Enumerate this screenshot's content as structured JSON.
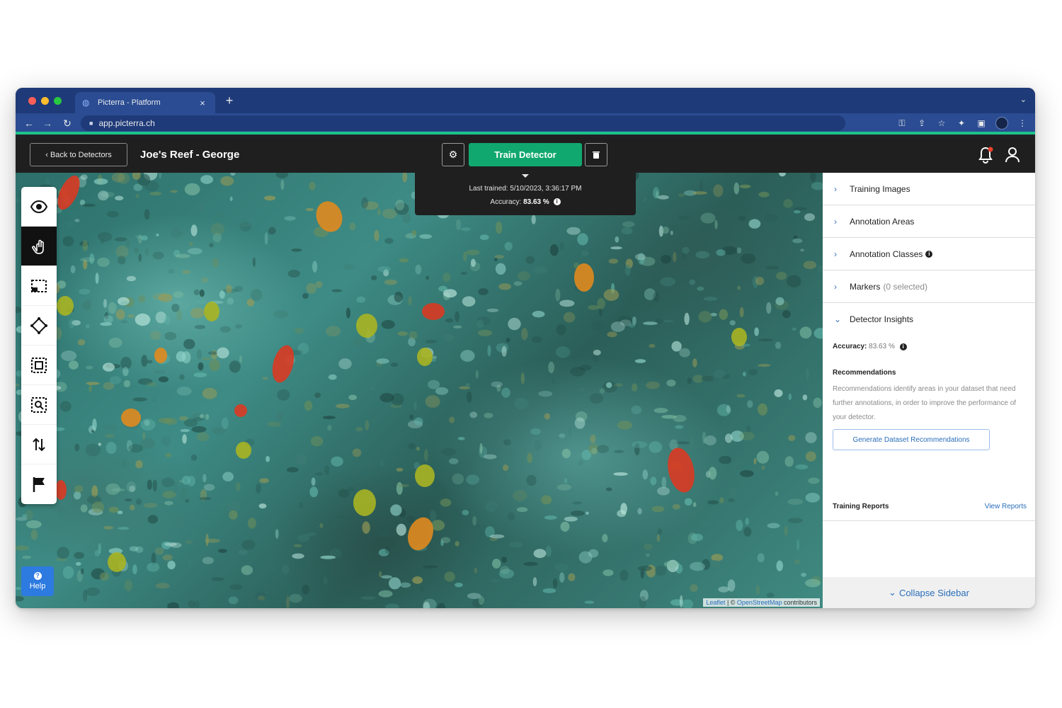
{
  "browser": {
    "tab_title": "Picterra - Platform",
    "tab_close": "×",
    "new_tab": "+",
    "url": "app.picterra.ch"
  },
  "header": {
    "back_label": "‹ Back to Detectors",
    "title": "Joe's Reef - George",
    "train_label": "Train Detector"
  },
  "training_info": {
    "last_trained": "Last trained: 5/10/2023, 3:36:17 PM",
    "accuracy_label": "Accuracy:",
    "accuracy_value": "83.63 %"
  },
  "toolbox": {
    "tools": [
      "eye-icon",
      "hand-icon",
      "selection-rect-icon",
      "polygon-icon",
      "focus-square-icon",
      "zoom-select-icon",
      "swap-icon",
      "flag-icon"
    ]
  },
  "help": {
    "label": "Help"
  },
  "attribution": {
    "leaflet": "Leaflet",
    "sep": " | © ",
    "osm": "OpenStreetMap",
    "suffix": " contributors"
  },
  "sidebar": {
    "items": [
      {
        "label": "Training Images"
      },
      {
        "label": "Annotation Areas"
      },
      {
        "label": "Annotation Classes"
      },
      {
        "label": "Markers",
        "muted": "(0 selected)"
      },
      {
        "label": "Detector Insights"
      }
    ],
    "insights": {
      "accuracy_label": "Accuracy:",
      "accuracy_value": "83.63 %",
      "rec_title": "Recommendations",
      "rec_desc": "Recommendations identify areas in your dataset that need further annotations, in order to improve the performance of your detector.",
      "gen_button": "Generate Dataset Recommendations",
      "reports_label": "Training Reports",
      "reports_link": "View Reports"
    },
    "collapse_label": "Collapse Sidebar"
  },
  "colors": {
    "accent_green": "#11a86f",
    "chrome_blue": "#2b4c92",
    "link_blue": "#2a6ebb",
    "annotation_red": "#d93a22",
    "annotation_orange": "#e08a1e",
    "annotation_yellow": "#a8b422"
  }
}
